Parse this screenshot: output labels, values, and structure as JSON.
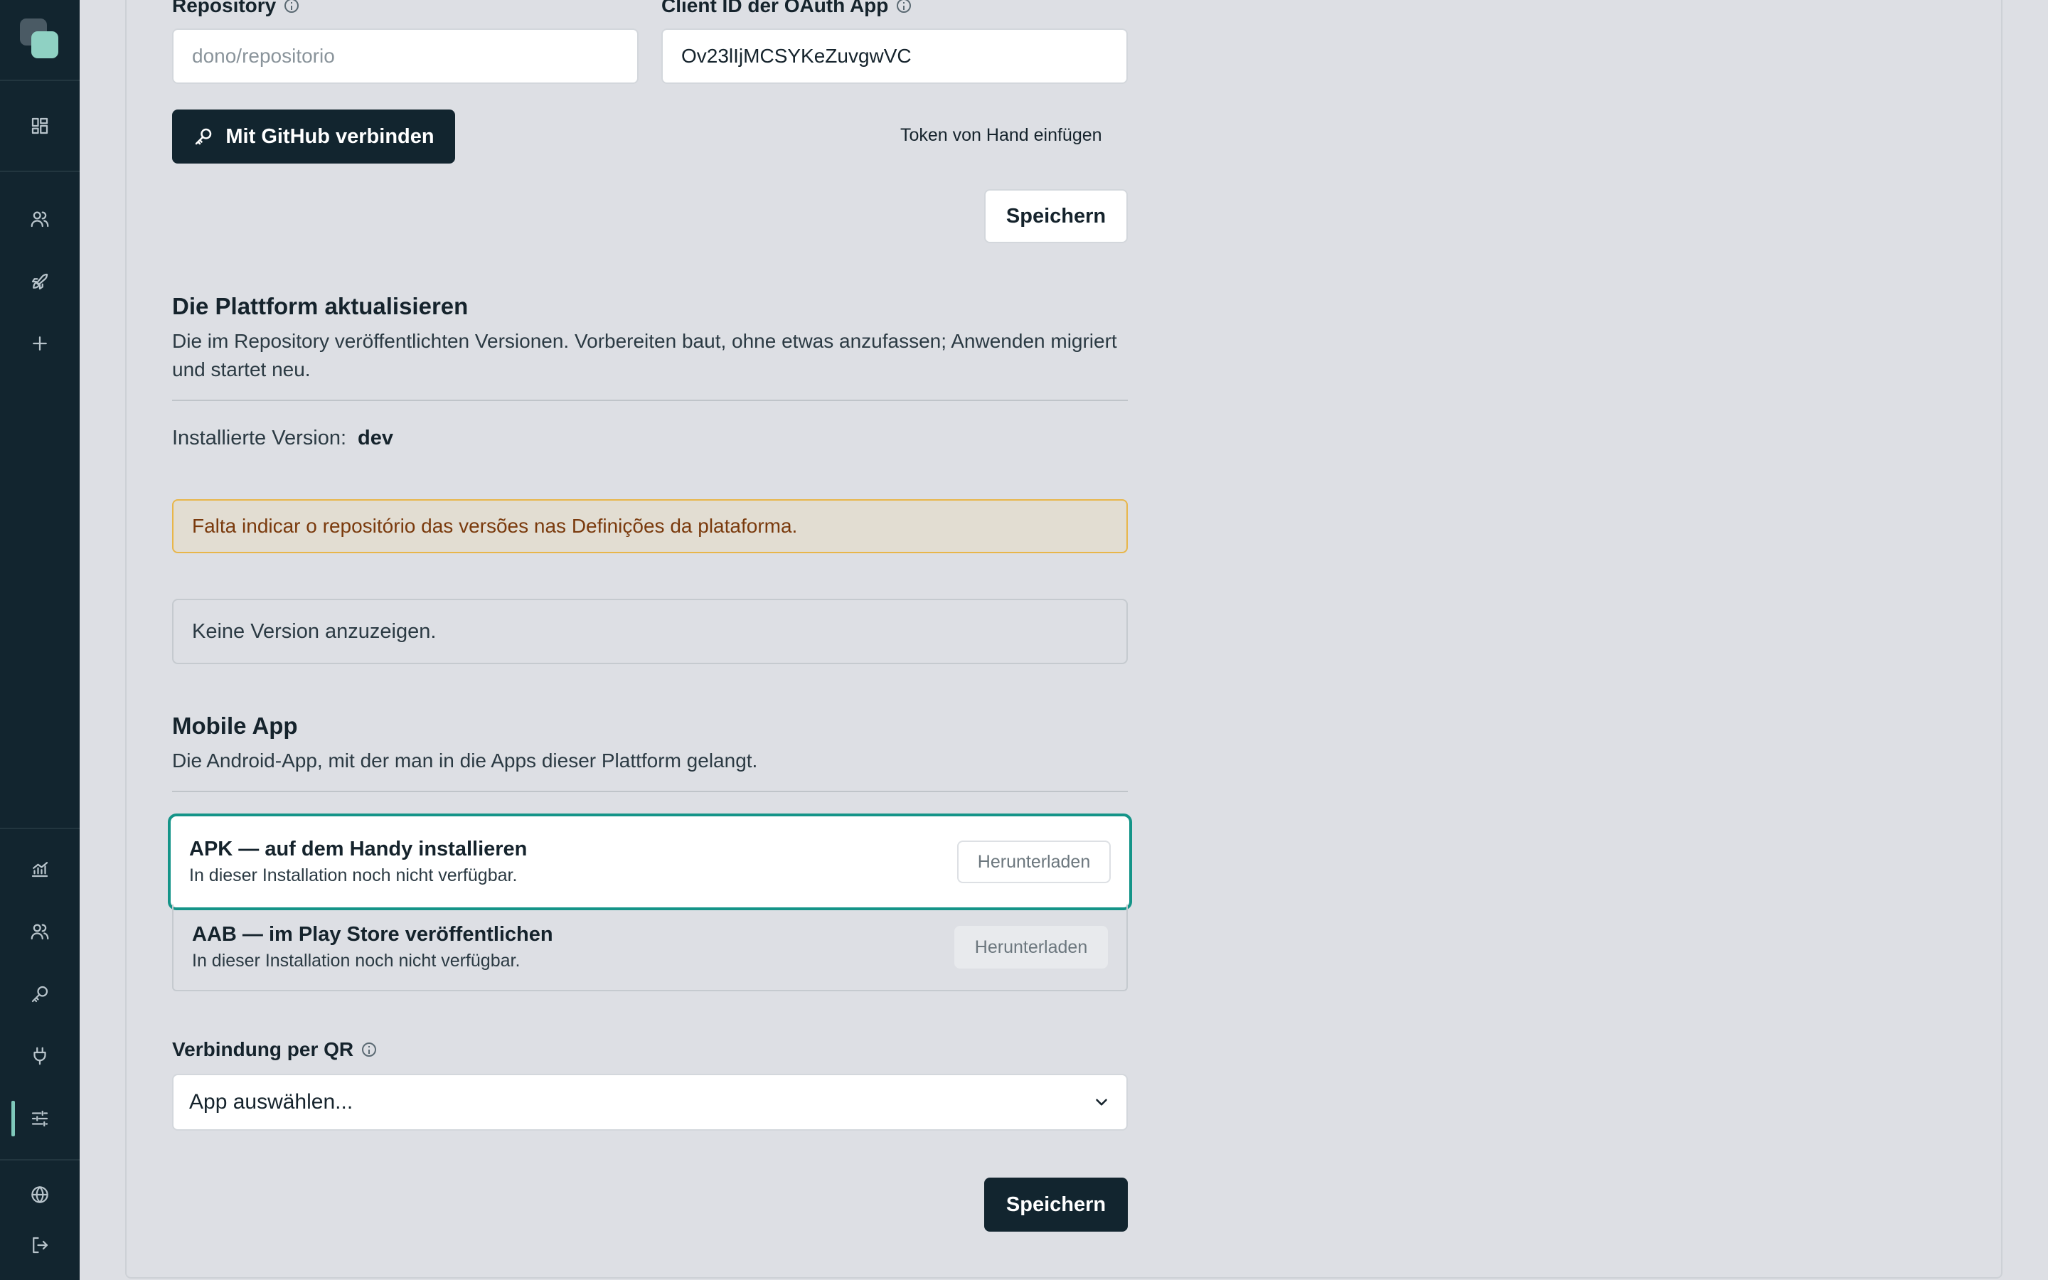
{
  "sidebar": {
    "top_icons": [
      "dashboard-icon",
      "users-icon",
      "rocket-icon",
      "plus-icon"
    ],
    "bottom_icons": [
      "chart-icon",
      "team-icon",
      "key-icon",
      "plug-icon",
      "sliders-icon"
    ],
    "footer_icons": [
      "globe-icon",
      "logout-icon"
    ],
    "active_item": "sliders-icon",
    "accent_color": "#7fc9bb"
  },
  "github": {
    "repository_label": "Repository",
    "repository_placeholder": "dono/repositorio",
    "client_id_label": "Client ID der OAuth App",
    "client_id_value": "Ov23lIjMCSYKeZuvgwVC",
    "connect_label": "Mit GitHub verbinden",
    "manual_token_label": "Token von Hand einfügen",
    "save_label": "Speichern"
  },
  "update": {
    "title": "Die Plattform aktualisieren",
    "description": "Die im Repository veröffentlichten Versionen. Vorbereiten baut, ohne etwas anzufassen; Anwenden migriert und startet neu.",
    "installed_label": "Installierte Version:",
    "installed_value": "dev",
    "warning": "Falta indicar o repositório das versões nas Definições da plataforma.",
    "warning_color": "#e8b64a",
    "empty_text": "Keine Version anzuzeigen."
  },
  "mobile": {
    "title": "Mobile App",
    "description": "Die Android-App, mit der man in die Apps dieser Plattform gelangt.",
    "apk_title": "APK — auf dem Handy installieren",
    "apk_subtitle": "In dieser Installation noch nicht verfügbar.",
    "aab_title": "AAB — im Play Store veröffentlichen",
    "aab_subtitle": "In dieser Installation noch nicht verfügbar.",
    "download_label": "Herunterladen",
    "focus_color": "#149488"
  },
  "qr": {
    "label": "Verbindung per QR",
    "select_value": "App auswählen...",
    "save_label": "Speichern"
  }
}
